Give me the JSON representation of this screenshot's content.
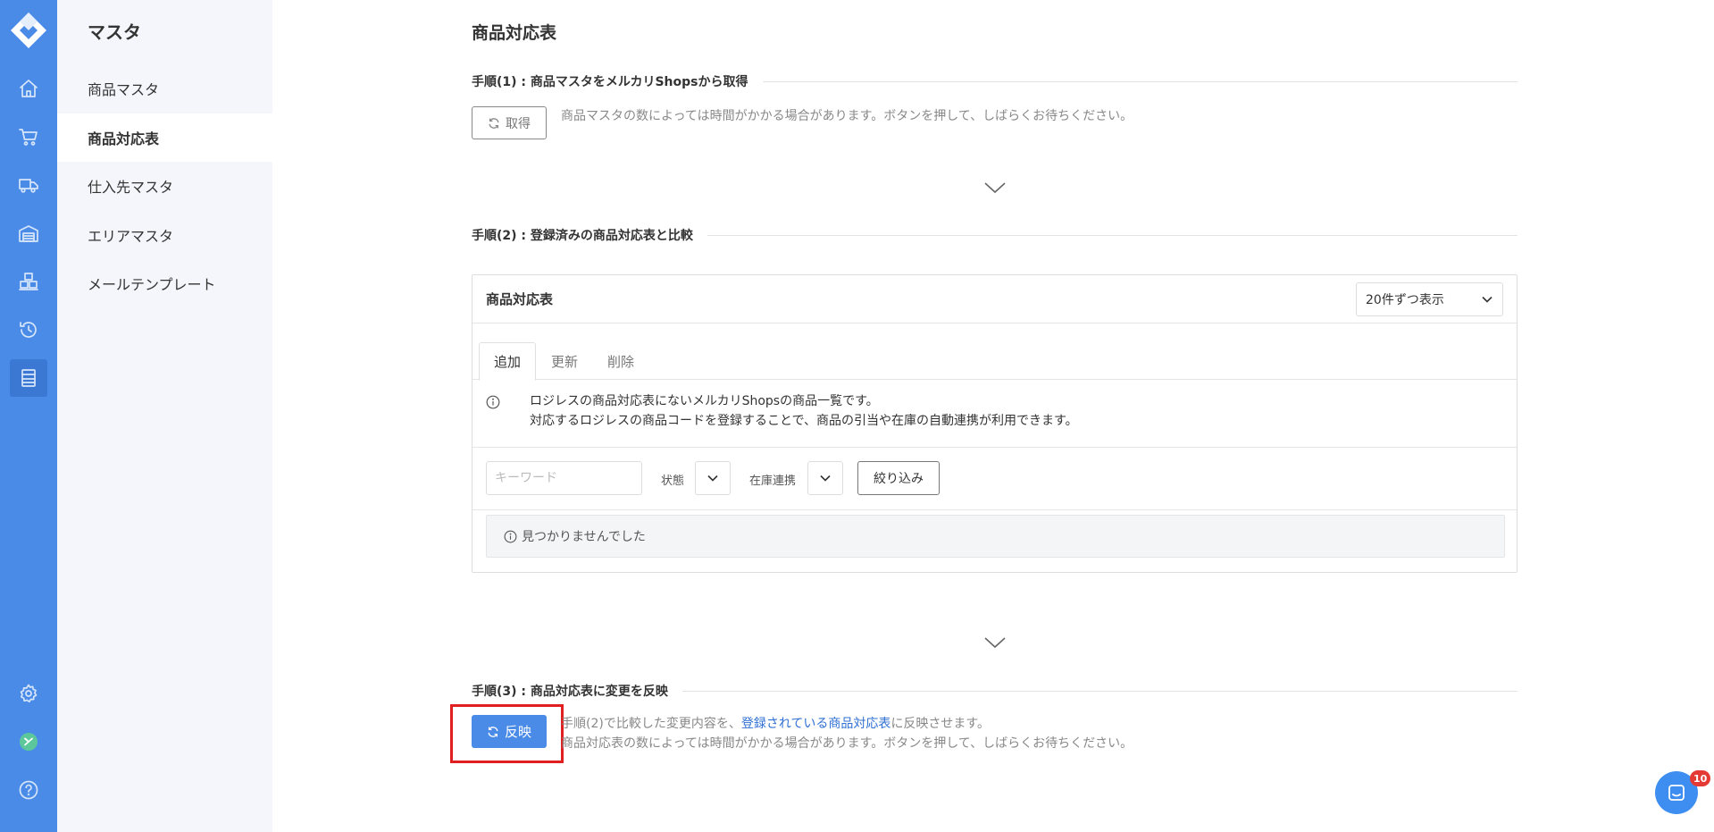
{
  "sidebar": {
    "title": "マスタ",
    "items": [
      {
        "label": "商品マスタ"
      },
      {
        "label": "商品対応表"
      },
      {
        "label": "仕入先マスタ"
      },
      {
        "label": "エリアマスタ"
      },
      {
        "label": "メールテンプレート"
      }
    ]
  },
  "page": {
    "title": "商品対応表",
    "step1": {
      "heading": "手順(1) : 商品マスタをメルカリShopsから取得",
      "button": "取得",
      "hint": "商品マスタの数によっては時間がかかる場合があります。ボタンを押して、しばらくお待ちください。"
    },
    "step2": {
      "heading": "手順(2) : 登録済みの商品対応表と比較",
      "panel_title": "商品対応表",
      "page_size": "20件ずつ表示",
      "tabs": [
        "追加",
        "更新",
        "削除"
      ],
      "info_line1": "ロジレスの商品対応表にないメルカリShopsの商品一覧です。",
      "info_line2": "対応するロジレスの商品コードを登録することで、商品の引当や在庫の自動連携が利用できます。",
      "keyword_placeholder": "キーワード",
      "status_label": "状態",
      "stock_label": "在庫連携",
      "filter_button": "絞り込み",
      "empty_message": "見つかりませんでした"
    },
    "step3": {
      "heading": "手順(3) : 商品対応表に変更を反映",
      "button": "反映",
      "hint_prefix": "手順(2)で比較した変更内容を、",
      "hint_link": "登録されている商品対応表",
      "hint_suffix": "に反映させます。",
      "hint2": "商品対応表の数によっては時間がかかる場合があります。ボタンを押して、しばらくお待ちください。"
    }
  },
  "chat": {
    "badge": "10"
  },
  "colors": {
    "accent": "#4a8be8",
    "highlight": "#e02020",
    "link": "#2f6fd3"
  }
}
